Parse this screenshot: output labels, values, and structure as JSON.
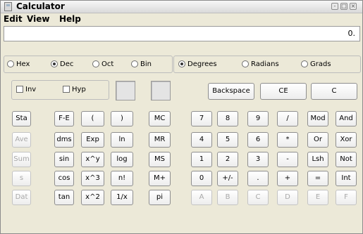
{
  "window": {
    "title": "Calculator"
  },
  "menu": {
    "edit": "Edit",
    "view": "View",
    "help": "Help"
  },
  "display": {
    "value": "0."
  },
  "base": {
    "hex": "Hex",
    "dec": "Dec",
    "oct": "Oct",
    "bin": "Bin",
    "selected": "Dec"
  },
  "angle": {
    "degrees": "Degrees",
    "radians": "Radians",
    "grads": "Grads",
    "selected": "Degrees"
  },
  "options": {
    "inv": "Inv",
    "hyp": "Hyp"
  },
  "keys": {
    "backspace": "Backspace",
    "ce": "CE",
    "c": "C",
    "sta": "Sta",
    "ave": "Ave",
    "sum": "Sum",
    "s": "s",
    "dat": "Dat",
    "fe": "F-E",
    "dms": "dms",
    "sin": "sin",
    "cos": "cos",
    "tan": "tan",
    "lparen": "(",
    "exp": "Exp",
    "xpowy": "x^y",
    "xcube": "x^3",
    "xsq": "x^2",
    "rparen": ")",
    "ln": "ln",
    "log": "log",
    "fact": "n!",
    "recip": "1/x",
    "mc": "MC",
    "mr": "MR",
    "ms": "MS",
    "mplus": "M+",
    "pi": "pi",
    "n7": "7",
    "n8": "8",
    "n9": "9",
    "div": "/",
    "mod": "Mod",
    "and": "And",
    "n4": "4",
    "n5": "5",
    "n6": "6",
    "mul": "*",
    "or": "Or",
    "xor": "Xor",
    "n1": "1",
    "n2": "2",
    "n3": "3",
    "sub": "-",
    "lsh": "Lsh",
    "not": "Not",
    "n0": "0",
    "neg": "+/-",
    "dot": ".",
    "add": "+",
    "eq": "=",
    "int": "Int",
    "a": "A",
    "b": "B",
    "cc": "C",
    "d": "D",
    "e": "E",
    "f": "F"
  }
}
